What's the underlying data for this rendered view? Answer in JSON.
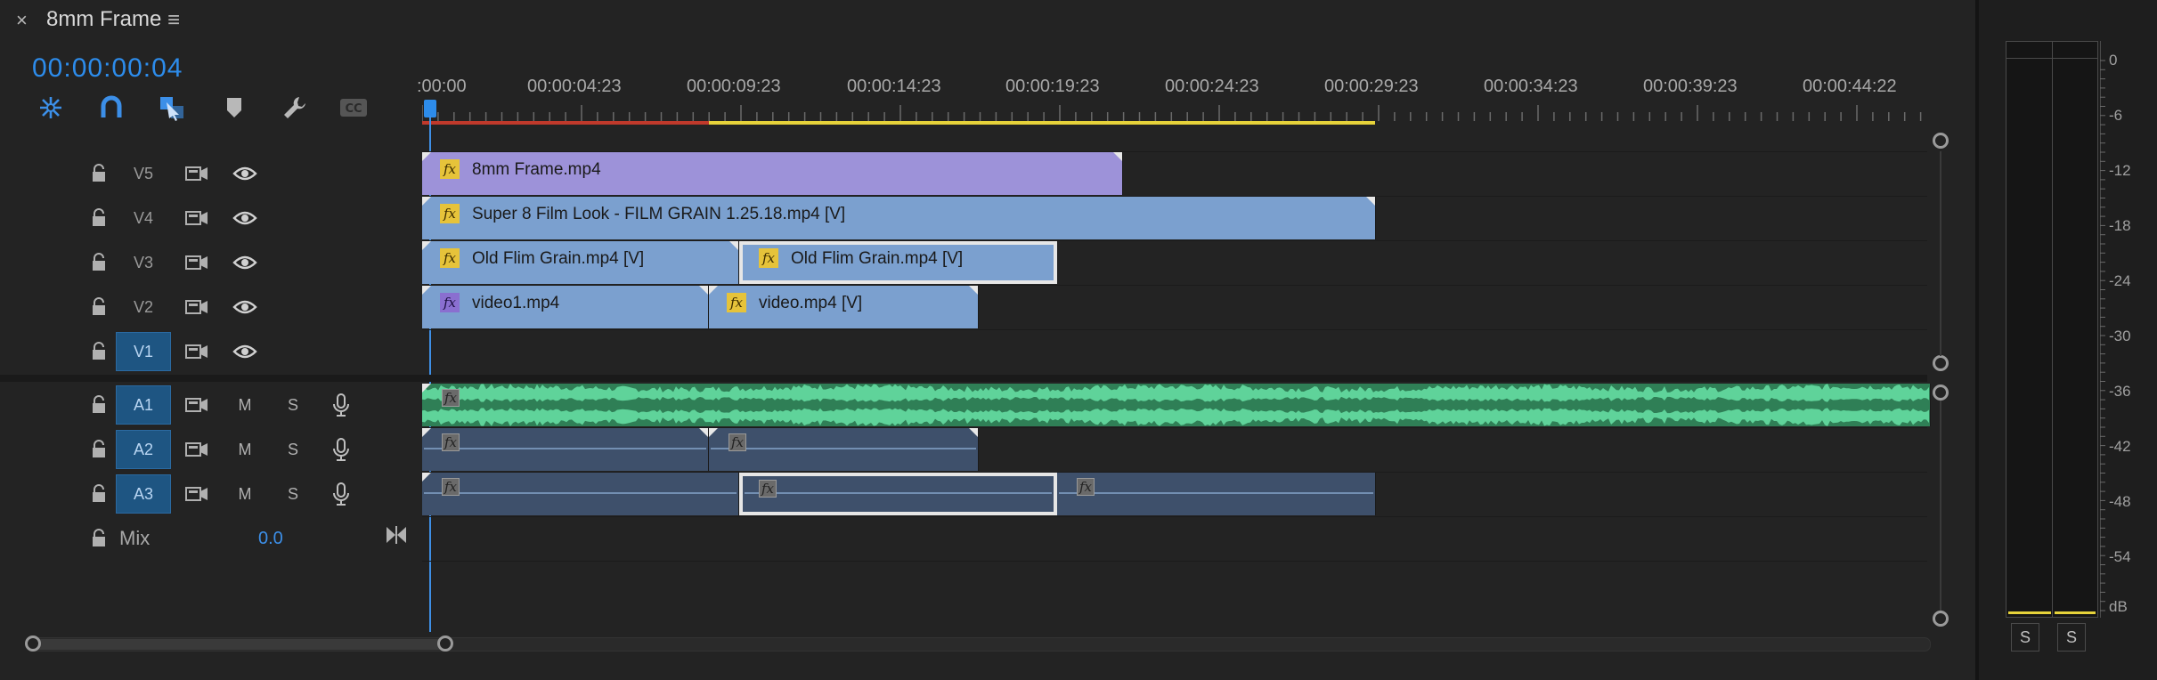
{
  "tab": {
    "title": "8mm Frame",
    "close": "×",
    "menu": "≡"
  },
  "timecode": "00:00:00:04",
  "ruler": {
    "labels": [
      ":00:00",
      "00:00:04:23",
      "00:00:09:23",
      "00:00:14:23",
      "00:00:19:23",
      "00:00:24:23",
      "00:00:29:23",
      "00:00:34:23",
      "00:00:39:23",
      "00:00:44:22"
    ]
  },
  "tracks": {
    "video": [
      {
        "name": "V5"
      },
      {
        "name": "V4"
      },
      {
        "name": "V3"
      },
      {
        "name": "V2"
      },
      {
        "name": "V1"
      }
    ],
    "audio": [
      {
        "name": "A1",
        "m": "M",
        "s": "S"
      },
      {
        "name": "A2",
        "m": "M",
        "s": "S"
      },
      {
        "name": "A3",
        "m": "M",
        "s": "S"
      }
    ],
    "mix": {
      "label": "Mix",
      "value": "0.0"
    }
  },
  "clips": {
    "v5_1": "8mm Frame.mp4",
    "v4_1": "Super 8 Film Look - FILM GRAIN 1.25.18.mp4 [V]",
    "v3_1": "Old Flim Grain.mp4 [V]",
    "v3_2": "Old Flim Grain.mp4 [V]",
    "v2_1": "video1.mp4",
    "v2_2": "video.mp4 [V]",
    "fx": "fx"
  },
  "meter": {
    "db_labels": [
      "0",
      "-6",
      "-12",
      "-18",
      "-24",
      "-30",
      "-36",
      "-42",
      "-48",
      "-54",
      "dB"
    ],
    "solo_left": "S",
    "solo_right": "S"
  },
  "colors": {
    "timecode": "#2d8ceb",
    "video_clip": "#7ba0cf",
    "purple_clip": "#9d92d9",
    "audio_clip": "#3e506b",
    "audio_waveform": "#5fd39a",
    "track_active": "#1e5582",
    "work_area_red": "#c0392b",
    "work_area_yellow": "#e6d23a"
  }
}
